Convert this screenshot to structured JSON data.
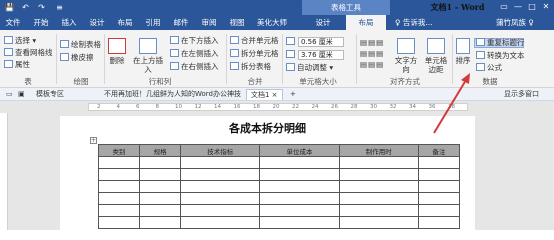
{
  "titlebar": {
    "doc_title": "文档1 - Word",
    "tool_title": "表格工具",
    "quick_access": [
      "💾",
      "↶",
      "↷",
      "≡"
    ],
    "window_buttons": [
      "▭",
      "—",
      "□",
      "✕"
    ]
  },
  "tabs": [
    {
      "label": "文件"
    },
    {
      "label": "开始"
    },
    {
      "label": "插入"
    },
    {
      "label": "设计"
    },
    {
      "label": "布局"
    },
    {
      "label": "引用"
    },
    {
      "label": "邮件"
    },
    {
      "label": "审阅"
    },
    {
      "label": "视图"
    },
    {
      "label": "美化大师"
    },
    {
      "label": "设计"
    },
    {
      "label": "布局"
    }
  ],
  "tell_me": "♀ 告诉我...",
  "share": "蒲竹凤族 ♀",
  "ribbon": {
    "table": {
      "select": "选择 ▾",
      "gridlines": "查看网格线",
      "properties": "属性",
      "group": "表"
    },
    "draw": {
      "draw_table": "绘制表格",
      "eraser": "橡皮擦",
      "group": "绘图"
    },
    "rows_cols": {
      "delete": "删除",
      "insert_above": "在上方插入",
      "insert_below": "在下方插入",
      "insert_left": "在左侧插入",
      "insert_right": "在右侧插入",
      "group": "行和列"
    },
    "merge": {
      "merge_cells": "合并单元格",
      "split_cells": "拆分单元格",
      "split_table": "拆分表格",
      "group": "合并"
    },
    "cell_size": {
      "height": "0.56 厘米",
      "width": "3.76 厘米",
      "autofit": "自动调整 ▾",
      "group": "单元格大小"
    },
    "alignment": {
      "text_direction": "文字方向",
      "cell_margins": "单元格边距",
      "group": "对齐方式"
    },
    "data": {
      "sort": "排序",
      "repeat_header": "重复标题行",
      "convert_text": "转换为文本",
      "formula": "公式",
      "group": "数据"
    }
  },
  "docbar": {
    "templates": "模板专区",
    "tip": "不用再加班！几组鲜为人知的Word办公神技",
    "doc_tab": "文档1 ×",
    "show_more": "显示多窗口"
  },
  "ruler_marks": [
    "2",
    "4",
    "6",
    "8",
    "10",
    "12",
    "14",
    "16",
    "18",
    "20",
    "22",
    "24",
    "26",
    "28",
    "30",
    "32",
    "34",
    "36",
    "38"
  ],
  "document": {
    "title": "各成本拆分明细",
    "headers": [
      "类别",
      "规格",
      "技术指标",
      "单位成本",
      "制作用时",
      "备注"
    ],
    "empty_rows": 6
  },
  "colors": {
    "brand": "#2b579a",
    "tool_tab": "#5b84c4",
    "header_fill": "#a6a6a6",
    "arrow": "#d23b3b"
  }
}
